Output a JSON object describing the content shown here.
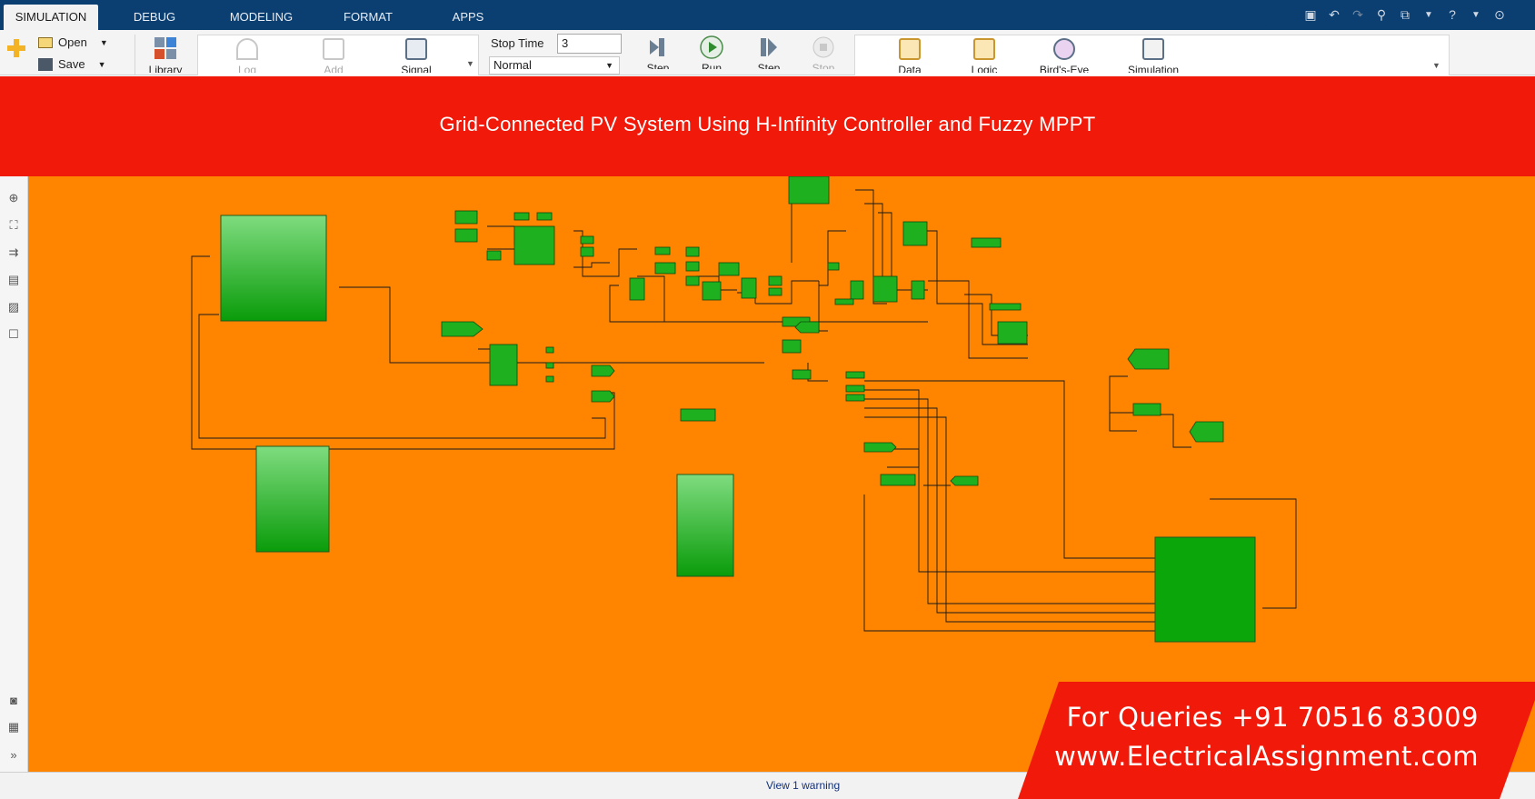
{
  "tabs": [
    {
      "label": "SIMULATION",
      "active": true
    },
    {
      "label": "DEBUG",
      "active": false
    },
    {
      "label": "MODELING",
      "active": false
    },
    {
      "label": "FORMAT",
      "active": false
    },
    {
      "label": "APPS",
      "active": false
    }
  ],
  "toolstrip": {
    "file": {
      "open_label": "Open",
      "save_label": "Save"
    },
    "library_label": "Library",
    "log_label": "Log",
    "add_label": "Add",
    "signal_label": "Signal",
    "stop_time_label": "Stop Time",
    "stop_time_value": "3",
    "sim_mode": "Normal",
    "step_back_label": "Step",
    "run_label": "Run",
    "step_forward_label": "Step",
    "stop_label": "Stop",
    "data_label": "Data",
    "logic_label": "Logic",
    "birds_eye_label": "Bird's-Eye",
    "simulation_label": "Simulation"
  },
  "banner": {
    "title": "Grid-Connected PV System Using H-Infinity Controller and Fuzzy MPPT"
  },
  "status": {
    "warning_text": "View 1 warning"
  },
  "promo": {
    "line1": "For Queries +91 70516 83009",
    "line2": "www.ElectricalAssignment.com"
  },
  "colors": {
    "canvas": "#ff8400",
    "block": "#00a000",
    "banner": "#f11a0a",
    "tabbar": "#0b3f72"
  }
}
